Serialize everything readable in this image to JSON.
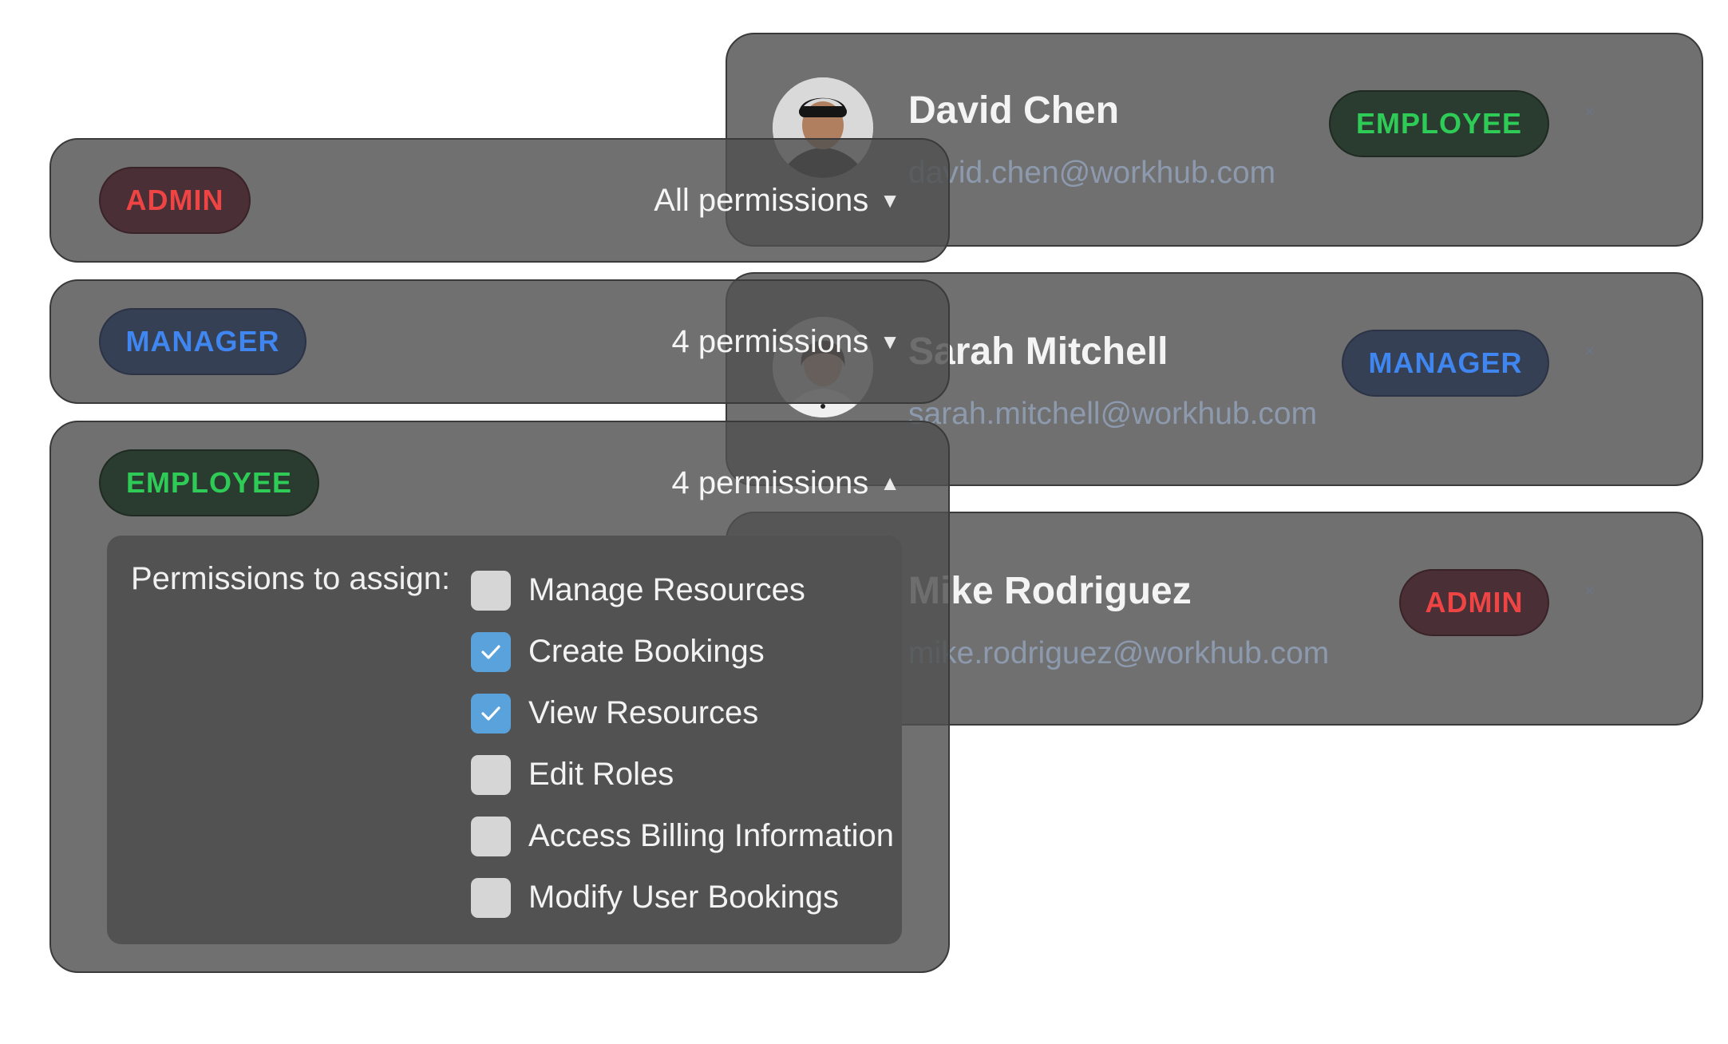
{
  "users": [
    {
      "name": "David Chen",
      "email": "david.chen@workhub.com",
      "role": "EMPLOYEE",
      "role_key": "employee",
      "remove_icon": "close-icon",
      "remove_glyph": "×"
    },
    {
      "name": "Sarah Mitchell",
      "email": "sarah.mitchell@workhub.com",
      "role": "MANAGER",
      "role_key": "manager",
      "remove_icon": "close-icon",
      "remove_glyph": "×"
    },
    {
      "name": "Mike Rodriguez",
      "email": "mike.rodriguez@workhub.com",
      "role": "ADMIN",
      "role_key": "admin",
      "remove_icon": "close-icon",
      "remove_glyph": "×"
    }
  ],
  "roles": [
    {
      "role": "ADMIN",
      "permissions_label": "All permissions",
      "caret": "▼",
      "expanded": false
    },
    {
      "role": "MANAGER",
      "permissions_label": "4 permissions",
      "caret": "▼",
      "expanded": false
    },
    {
      "role": "EMPLOYEE",
      "permissions_label": "4 permissions",
      "caret": "▲",
      "expanded": true
    }
  ],
  "permissions_panel": {
    "label": "Permissions to assign:",
    "items": [
      {
        "label": "Manage Resources",
        "checked": false
      },
      {
        "label": "Create Bookings",
        "checked": true
      },
      {
        "label": "View Resources",
        "checked": true
      },
      {
        "label": "Edit Roles",
        "checked": false
      },
      {
        "label": "Access Billing Information",
        "checked": false
      },
      {
        "label": "Modify User Bookings",
        "checked": false
      }
    ]
  },
  "colors": {
    "employee": "#2ecc57",
    "manager": "#3f86f0",
    "admin": "#ef4444",
    "checkbox_checked": "#5aa2dc"
  }
}
